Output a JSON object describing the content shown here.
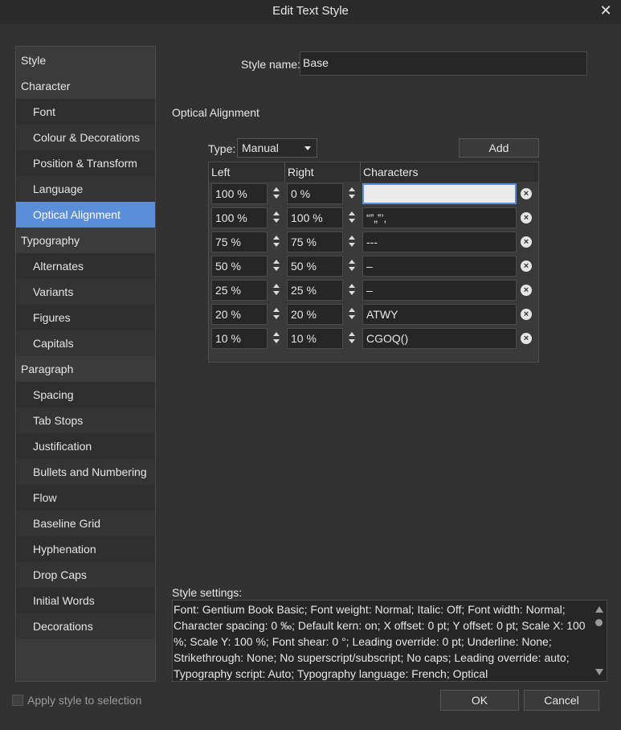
{
  "window": {
    "title": "Edit Text Style"
  },
  "sidebar": {
    "items": [
      {
        "label": "Style",
        "kind": "cat"
      },
      {
        "label": "Character",
        "kind": "cat"
      },
      {
        "label": "Font",
        "kind": "sub"
      },
      {
        "label": "Colour & Decorations",
        "kind": "sub"
      },
      {
        "label": "Position & Transform",
        "kind": "sub"
      },
      {
        "label": "Language",
        "kind": "sub"
      },
      {
        "label": "Optical Alignment",
        "kind": "sub",
        "active": true
      },
      {
        "label": "Typography",
        "kind": "cat"
      },
      {
        "label": "Alternates",
        "kind": "sub"
      },
      {
        "label": "Variants",
        "kind": "sub"
      },
      {
        "label": "Figures",
        "kind": "sub"
      },
      {
        "label": "Capitals",
        "kind": "sub"
      },
      {
        "label": "Paragraph",
        "kind": "cat"
      },
      {
        "label": "Spacing",
        "kind": "sub"
      },
      {
        "label": "Tab Stops",
        "kind": "sub"
      },
      {
        "label": "Justification",
        "kind": "sub"
      },
      {
        "label": "Bullets and Numbering",
        "kind": "sub"
      },
      {
        "label": "Flow",
        "kind": "sub"
      },
      {
        "label": "Baseline Grid",
        "kind": "sub"
      },
      {
        "label": "Hyphenation",
        "kind": "sub"
      },
      {
        "label": "Drop Caps",
        "kind": "sub"
      },
      {
        "label": "Initial Words",
        "kind": "sub"
      },
      {
        "label": "Decorations",
        "kind": "sub"
      }
    ]
  },
  "style_name": {
    "label": "Style name:",
    "value": "Base"
  },
  "section": {
    "title": "Optical Alignment"
  },
  "type": {
    "label": "Type:",
    "value": "Manual"
  },
  "add_button": "Add",
  "table": {
    "headers": [
      "Left",
      "Right",
      "Characters"
    ],
    "rows": [
      {
        "left": "100 %",
        "right": "0 %",
        "chars": ""
      },
      {
        "left": "100 %",
        "right": "100 %",
        "chars": "“”„‟’‚"
      },
      {
        "left": "75 %",
        "right": "75 %",
        "chars": "---"
      },
      {
        "left": "50 %",
        "right": "50 %",
        "chars": "–"
      },
      {
        "left": "25 %",
        "right": "25 %",
        "chars": "–"
      },
      {
        "left": "20 %",
        "right": "20 %",
        "chars": "ATWY"
      },
      {
        "left": "10 %",
        "right": "10 %",
        "chars": "CGOQ()"
      }
    ]
  },
  "style_settings": {
    "label": "Style settings:",
    "text": "Font: Gentium Book Basic; Font weight: Normal; Italic: Off; Font width: Normal; Character spacing: 0 ‰; Default kern: on; X offset: 0 pt; Y offset: 0 pt; Scale X: 100 %; Scale Y: 100 %; Font shear: 0 °; Leading override: 0 pt; Underline: None; Strikethrough: None; No superscript/subscript; No caps; Leading override: auto; Typography script: Auto; Typography language: French; Optical"
  },
  "apply_to_selection": {
    "label": "Apply style to selection",
    "checked": false
  },
  "ok_button": "OK",
  "cancel_button": "Cancel",
  "colors": {
    "accent": "#5a8ed8",
    "background": "#323232",
    "field": "#262626"
  }
}
